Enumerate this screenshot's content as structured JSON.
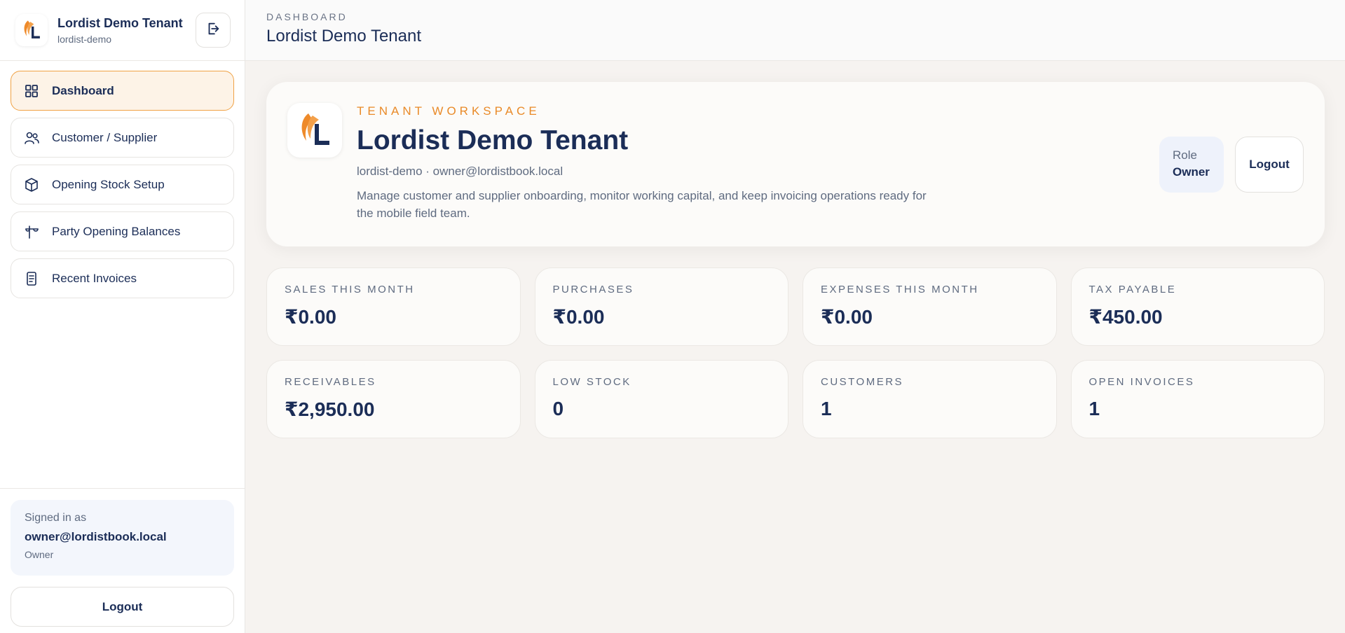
{
  "brand": {
    "title": "Lordist Demo Tenant",
    "subtitle": "lordist-demo",
    "logo_icon": "lordist-logo-icon",
    "collapse_icon": "logout-arrow-icon"
  },
  "sidebar": {
    "items": [
      {
        "label": "Dashboard",
        "icon": "grid-icon",
        "active": true
      },
      {
        "label": "Customer / Supplier",
        "icon": "users-icon",
        "active": false
      },
      {
        "label": "Opening Stock Setup",
        "icon": "box-icon",
        "active": false
      },
      {
        "label": "Party Opening Balances",
        "icon": "scale-icon",
        "active": false
      },
      {
        "label": "Recent Invoices",
        "icon": "receipt-icon",
        "active": false
      }
    ],
    "signed_in": {
      "label": "Signed in as",
      "email": "owner@lordistbook.local",
      "role": "Owner"
    },
    "logout_label": "Logout"
  },
  "topbar": {
    "breadcrumb": "DASHBOARD",
    "title": "Lordist Demo Tenant"
  },
  "hero": {
    "eyebrow": "TENANT WORKSPACE",
    "title": "Lordist Demo Tenant",
    "meta": "lordist-demo · owner@lordistbook.local",
    "description": "Manage customer and supplier onboarding, monitor working capital, and keep invoicing operations ready for the mobile field team.",
    "role_label": "Role",
    "role_value": "Owner",
    "logout_label": "Logout"
  },
  "stats": [
    {
      "label": "SALES THIS MONTH",
      "value": "₹0.00"
    },
    {
      "label": "PURCHASES",
      "value": "₹0.00"
    },
    {
      "label": "EXPENSES THIS MONTH",
      "value": "₹0.00"
    },
    {
      "label": "TAX PAYABLE",
      "value": "₹450.00"
    },
    {
      "label": "RECEIVABLES",
      "value": "₹2,950.00"
    },
    {
      "label": "LOW STOCK",
      "value": "0"
    },
    {
      "label": "CUSTOMERS",
      "value": "1"
    },
    {
      "label": "OPEN INVOICES",
      "value": "1"
    }
  ],
  "colors": {
    "accent": "#f0a245",
    "eyebrow": "#e98a28",
    "navy": "#1b2d57",
    "muted": "#5f6b80"
  }
}
